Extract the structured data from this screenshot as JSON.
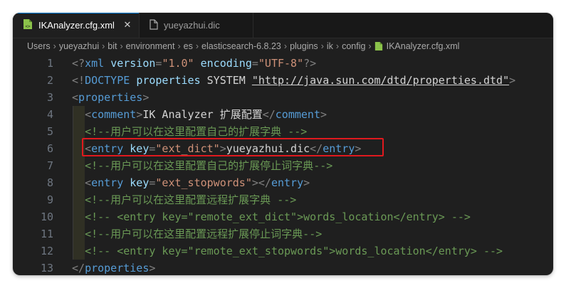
{
  "tabs": [
    {
      "label": "IKAnalyzer.cfg.xml",
      "active": true,
      "icon": "xml-file-icon"
    },
    {
      "label": "yueyazhui.dic",
      "active": false,
      "icon": "text-file-icon"
    }
  ],
  "breadcrumb": [
    "Users",
    "yueyazhui",
    "bit",
    "environment",
    "es",
    "elasticsearch-6.8.23",
    "plugins",
    "ik",
    "config",
    "IKAnalyzer.cfg.xml"
  ],
  "editor": {
    "line_numbers": [
      "1",
      "2",
      "3",
      "4",
      "5",
      "6",
      "7",
      "8",
      "9",
      "10",
      "11",
      "12",
      "13"
    ],
    "lines": [
      {
        "n": "1",
        "tokens": [
          [
            "punct",
            "<?"
          ],
          [
            "tag",
            "xml"
          ],
          [
            "text",
            " "
          ],
          [
            "attr",
            "version"
          ],
          [
            "punct",
            "="
          ],
          [
            "val",
            "\"1.0\""
          ],
          [
            "text",
            " "
          ],
          [
            "attr",
            "encoding"
          ],
          [
            "punct",
            "="
          ],
          [
            "val",
            "\"UTF-8\""
          ],
          [
            "punct",
            "?>"
          ]
        ]
      },
      {
        "n": "2",
        "tokens": [
          [
            "punct",
            "<!"
          ],
          [
            "tag",
            "DOCTYPE"
          ],
          [
            "text",
            " "
          ],
          [
            "attr",
            "properties"
          ],
          [
            "text",
            " SYSTEM "
          ],
          [
            "link",
            "\"http://java.sun.com/dtd/properties.dtd\""
          ],
          [
            "punct",
            ">"
          ]
        ]
      },
      {
        "n": "3",
        "tokens": [
          [
            "punct",
            "<"
          ],
          [
            "tag",
            "properties"
          ],
          [
            "punct",
            ">"
          ]
        ]
      },
      {
        "n": "4",
        "tokens": [
          [
            "text",
            "  "
          ],
          [
            "punct",
            "<"
          ],
          [
            "tag",
            "comment"
          ],
          [
            "punct",
            ">"
          ],
          [
            "text",
            "IK Analyzer 扩展配置"
          ],
          [
            "punct",
            "</"
          ],
          [
            "tag",
            "comment"
          ],
          [
            "punct",
            ">"
          ]
        ]
      },
      {
        "n": "5",
        "tokens": [
          [
            "text",
            "  "
          ],
          [
            "comment",
            "<!--用户可以在这里配置自己的扩展字典 -->"
          ]
        ]
      },
      {
        "n": "6",
        "tokens": [
          [
            "text",
            "  "
          ],
          [
            "punct",
            "<"
          ],
          [
            "tag",
            "entry"
          ],
          [
            "text",
            " "
          ],
          [
            "attr",
            "key"
          ],
          [
            "punct",
            "="
          ],
          [
            "val",
            "\"ext_dict\""
          ],
          [
            "punct",
            ">"
          ],
          [
            "text",
            "yueyazhui.dic"
          ],
          [
            "punct",
            "</"
          ],
          [
            "tag",
            "entry"
          ],
          [
            "punct",
            ">"
          ]
        ]
      },
      {
        "n": "7",
        "tokens": [
          [
            "text",
            "  "
          ],
          [
            "comment",
            "<!--用户可以在这里配置自己的扩展停止词字典-->"
          ]
        ]
      },
      {
        "n": "8",
        "tokens": [
          [
            "text",
            "  "
          ],
          [
            "punct",
            "<"
          ],
          [
            "tag",
            "entry"
          ],
          [
            "text",
            " "
          ],
          [
            "attr",
            "key"
          ],
          [
            "punct",
            "="
          ],
          [
            "val",
            "\"ext_stopwords\""
          ],
          [
            "punct",
            "></"
          ],
          [
            "tag",
            "entry"
          ],
          [
            "punct",
            ">"
          ]
        ]
      },
      {
        "n": "9",
        "tokens": [
          [
            "text",
            "  "
          ],
          [
            "comment",
            "<!--用户可以在这里配置远程扩展字典 -->"
          ]
        ]
      },
      {
        "n": "10",
        "tokens": [
          [
            "text",
            "  "
          ],
          [
            "comment",
            "<!-- <entry key=\"remote_ext_dict\">words_location</entry> -->"
          ]
        ]
      },
      {
        "n": "11",
        "tokens": [
          [
            "text",
            "  "
          ],
          [
            "comment",
            "<!--用户可以在这里配置远程扩展停止词字典-->"
          ]
        ]
      },
      {
        "n": "12",
        "tokens": [
          [
            "text",
            "  "
          ],
          [
            "comment",
            "<!-- <entry key=\"remote_ext_stopwords\">words_location</entry> -->"
          ]
        ]
      },
      {
        "n": "13",
        "tokens": [
          [
            "punct",
            "</"
          ],
          [
            "tag",
            "properties"
          ],
          [
            "punct",
            ">"
          ]
        ]
      }
    ]
  },
  "colors": {
    "highlight_box": "#e0191e",
    "background": "#1f1f1f",
    "tag": "#569cd6",
    "attr": "#9cdcfe",
    "value": "#ce9178",
    "comment": "#6a9955"
  }
}
